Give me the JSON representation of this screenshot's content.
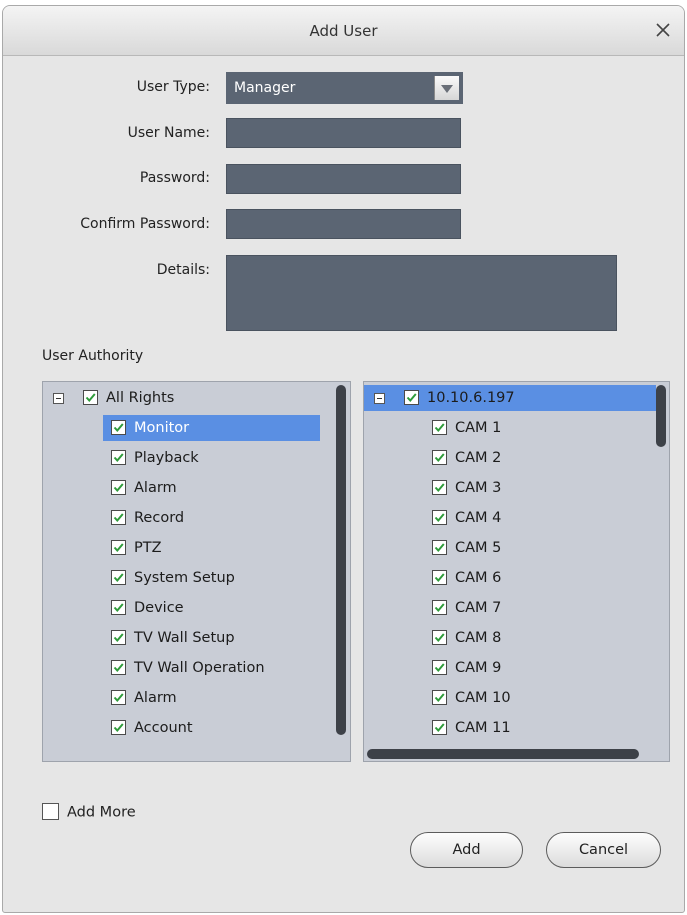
{
  "dialog": {
    "title": "Add User",
    "close_glyph": "×"
  },
  "form": {
    "user_type_label": "User Type:",
    "user_type_value": "Manager",
    "user_name_label": "User Name:",
    "user_name_value": "",
    "password_label": "Password:",
    "password_value": "",
    "confirm_password_label": "Confirm Password:",
    "confirm_password_value": "",
    "details_label": "Details:",
    "details_value": ""
  },
  "authority": {
    "label": "User Authority",
    "rights_root": "All Rights",
    "rights": [
      "Monitor",
      "Playback",
      "Alarm",
      "Record",
      "PTZ",
      "System Setup",
      "Device",
      "TV Wall Setup",
      "TV Wall Operation",
      "Alarm",
      "Account"
    ],
    "selected_right": "Monitor",
    "device_root": "10.10.6.197",
    "cameras": [
      "CAM 1",
      "CAM 2",
      "CAM 3",
      "CAM 4",
      "CAM 5",
      "CAM 6",
      "CAM 7",
      "CAM 8",
      "CAM 9",
      "CAM 10",
      "CAM 11"
    ]
  },
  "footer": {
    "add_more_label": "Add More",
    "add_more_checked": false,
    "add_button": "Add",
    "cancel_button": "Cancel"
  },
  "colors": {
    "field_bg": "#5b6573",
    "panel_bg": "#c9cdd6",
    "selection": "#5a8fe3",
    "check": "#2e9b3a"
  },
  "icons": {
    "close": "close-icon",
    "dropdown": "dropdown-arrow-icon",
    "check": "checkmark-icon",
    "collapse": "collapse-minus-icon"
  }
}
